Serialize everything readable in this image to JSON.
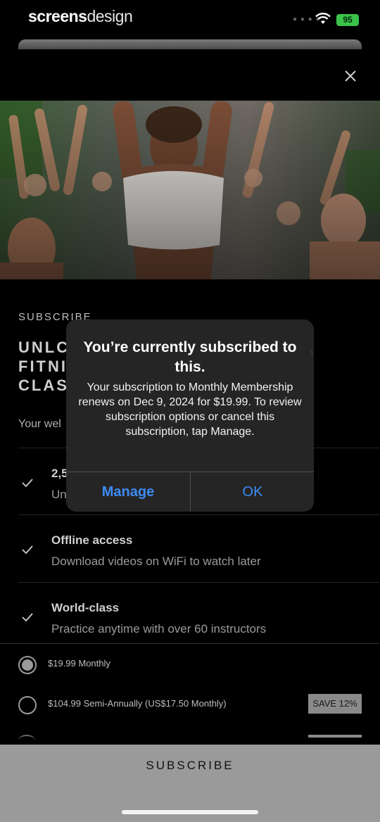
{
  "status_bar": {
    "brand_bold": "screens",
    "brand_light": "design",
    "battery": "95"
  },
  "paywall": {
    "overline": "SUBSCRIBE",
    "headline_lines": [
      "UNLC",
      "FITNI",
      "CLAS"
    ],
    "headline_right": ",",
    "welcome": "Your wel",
    "features": [
      {
        "title": "2,5",
        "desc": "Un"
      },
      {
        "title": "Offline access",
        "desc": "Download videos on WiFi to watch later"
      },
      {
        "title": "World-class",
        "desc": "Practice anytime with over 60 instructors"
      }
    ],
    "plans": [
      {
        "label": "$19.99 Monthly",
        "selected": true
      },
      {
        "label": "$104.99 Semi-Annually (US$17.50 Monthly)",
        "selected": false,
        "badge": "SAVE 12%"
      }
    ],
    "subscribe_button": "SUBSCRIBE"
  },
  "alert": {
    "title": "You’re currently subscribed to this.",
    "message": "Your subscription to Monthly Membership renews on Dec 9, 2024 for $19.99. To review subscription options or cancel this subscription, tap Manage.",
    "manage_button": "Manage",
    "ok_button": "OK",
    "button_color": "#3d8bf6"
  },
  "colors": {
    "background": "#000000",
    "subscribe_bar": "#9a9a9a",
    "battery": "#3ac34a"
  }
}
